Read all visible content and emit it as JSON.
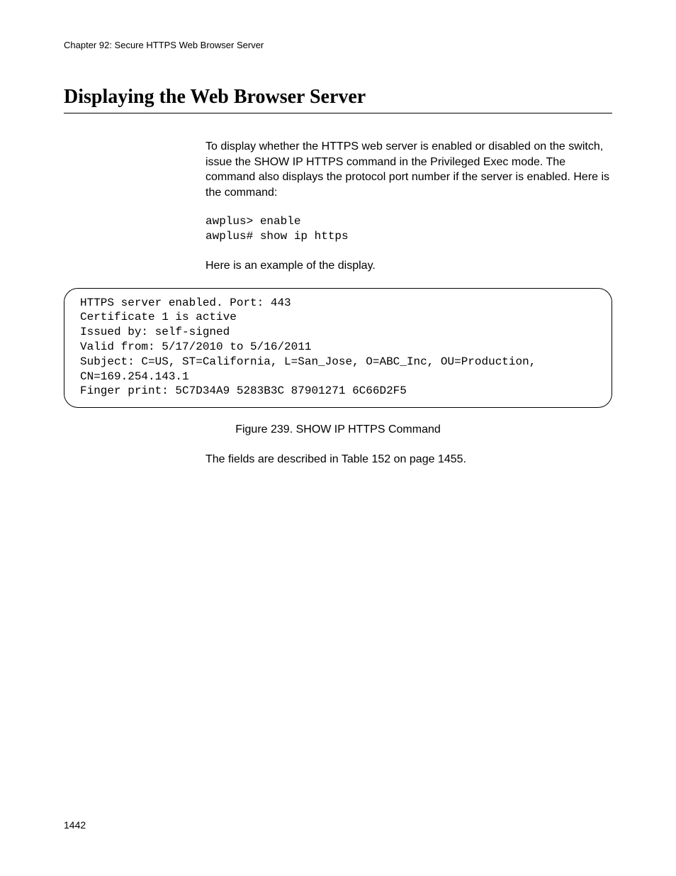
{
  "header": {
    "chapter": "Chapter 92: Secure HTTPS Web Browser Server"
  },
  "section": {
    "title": "Displaying the Web Browser Server"
  },
  "paragraphs": {
    "intro": "To display whether the HTTPS web server is enabled or disabled on the switch, issue the SHOW IP HTTPS command in the Privileged Exec mode. The command also displays the protocol port number if the server is enabled. Here is the command:",
    "example_lead": "Here is an example of the display.",
    "fields_ref": "The fields are described in Table 152 on page 1455."
  },
  "command": "awplus> enable\nawplus# show ip https",
  "output": "HTTPS server enabled. Port: 443\nCertificate 1 is active\nIssued by: self-signed\nValid from: 5/17/2010 to 5/16/2011\nSubject: C=US, ST=California, L=San_Jose, O=ABC_Inc, OU=Production, CN=169.254.143.1\nFinger print: 5C7D34A9 5283B3C 87901271 6C66D2F5",
  "figure": {
    "caption": "Figure 239. SHOW IP HTTPS Command"
  },
  "page_number": "1442"
}
